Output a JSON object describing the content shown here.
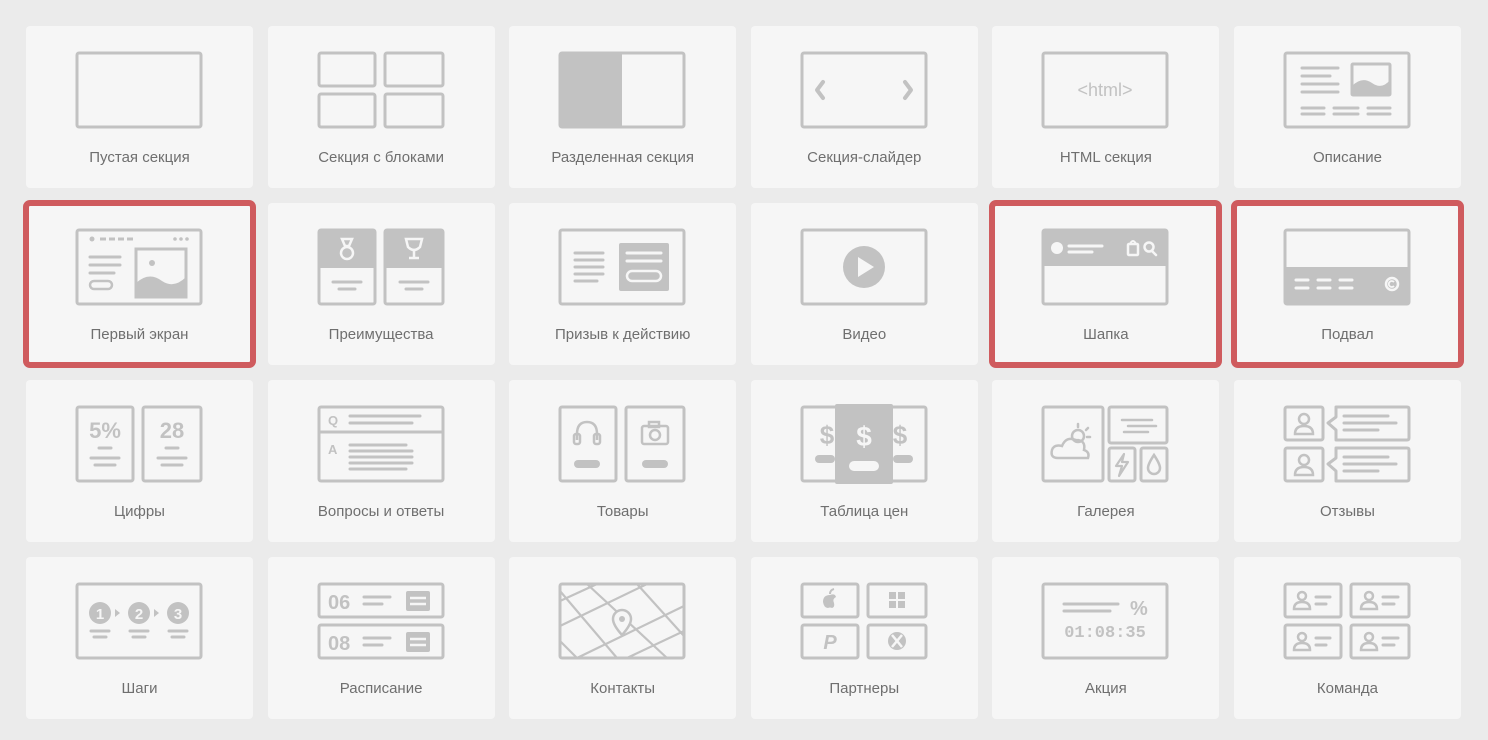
{
  "colors": {
    "background": "#ebebeb",
    "card": "#f6f6f6",
    "icon": "#c2c2c2",
    "text": "#6f6f6f",
    "selection": "#cf5b5e"
  },
  "sections": [
    {
      "label": "Пустая секция",
      "icon": "empty-section-icon",
      "selected": false
    },
    {
      "label": "Секция с блоками",
      "icon": "blocks-section-icon",
      "selected": false
    },
    {
      "label": "Разделенная секция",
      "icon": "split-section-icon",
      "selected": false
    },
    {
      "label": "Секция-слайдер",
      "icon": "slider-section-icon",
      "selected": false
    },
    {
      "label": "HTML секция",
      "icon": "html-section-icon",
      "selected": false
    },
    {
      "label": "Описание",
      "icon": "description-icon",
      "selected": false
    },
    {
      "label": "Первый экран",
      "icon": "hero-screen-icon",
      "selected": true
    },
    {
      "label": "Преимущества",
      "icon": "advantages-icon",
      "selected": false
    },
    {
      "label": "Призыв к действию",
      "icon": "call-to-action-icon",
      "selected": false
    },
    {
      "label": "Видео",
      "icon": "video-icon",
      "selected": false
    },
    {
      "label": "Шапка",
      "icon": "header-icon",
      "selected": true
    },
    {
      "label": "Подвал",
      "icon": "footer-icon",
      "selected": true
    },
    {
      "label": "Цифры",
      "icon": "numbers-icon",
      "selected": false
    },
    {
      "label": "Вопросы и ответы",
      "icon": "faq-icon",
      "selected": false
    },
    {
      "label": "Товары",
      "icon": "products-icon",
      "selected": false
    },
    {
      "label": "Таблица цен",
      "icon": "pricing-table-icon",
      "selected": false
    },
    {
      "label": "Галерея",
      "icon": "gallery-icon",
      "selected": false
    },
    {
      "label": "Отзывы",
      "icon": "reviews-icon",
      "selected": false
    },
    {
      "label": "Шаги",
      "icon": "steps-icon",
      "selected": false
    },
    {
      "label": "Расписание",
      "icon": "schedule-icon",
      "selected": false
    },
    {
      "label": "Контакты",
      "icon": "contacts-icon",
      "selected": false
    },
    {
      "label": "Партнеры",
      "icon": "partners-icon",
      "selected": false
    },
    {
      "label": "Акция",
      "icon": "promo-icon",
      "selected": false
    },
    {
      "label": "Команда",
      "icon": "team-icon",
      "selected": false
    }
  ],
  "icon_text": {
    "html": "<html>",
    "percent": "5%",
    "days": "28",
    "q": "Q",
    "a": "A",
    "dollar": "$",
    "num_1": "1",
    "num_2": "2",
    "num_3": "3",
    "sched_1": "06",
    "sched_2": "08",
    "promo_percent": "%",
    "timer": "01:08:35",
    "paypal": "P"
  }
}
